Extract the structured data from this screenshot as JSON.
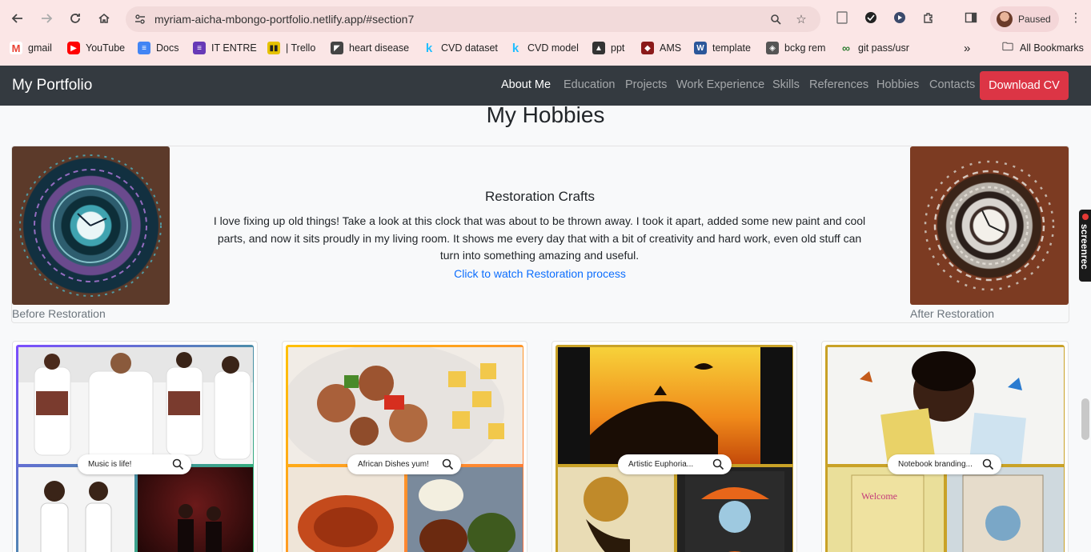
{
  "browser": {
    "url": "myriam-aicha-mbongo-portfolio.netlify.app/#section7",
    "profile_status": "Paused",
    "bookmarks": [
      {
        "label": "gmail",
        "icon": "gmail-icon",
        "color": "#ea4335"
      },
      {
        "label": "YouTube",
        "icon": "youtube-icon",
        "color": "#ff0000"
      },
      {
        "label": "Docs",
        "icon": "docs-icon",
        "color": "#4285f4"
      },
      {
        "label": "IT ENTRE",
        "icon": "forms-icon",
        "color": "#673ab7"
      },
      {
        "label": "| Trello",
        "icon": "trello-icon",
        "color": "#e6c200"
      },
      {
        "label": "heart disease",
        "icon": "kaggle-icon",
        "color": "#444444"
      },
      {
        "label": "CVD dataset",
        "icon": "kaggle-k-icon",
        "color": "#20beff"
      },
      {
        "label": "CVD model",
        "icon": "kaggle-k-icon",
        "color": "#20beff"
      },
      {
        "label": "ppt",
        "icon": "ppt-icon",
        "color": "#333333"
      },
      {
        "label": "AMS",
        "icon": "ams-icon",
        "color": "#8b1a1a"
      },
      {
        "label": "template",
        "icon": "word-icon",
        "color": "#2b579a"
      },
      {
        "label": "bckg rem",
        "icon": "layers-icon",
        "color": "#555555"
      },
      {
        "label": "git pass/usr",
        "icon": "git-icon",
        "color": "#2e7d32"
      }
    ],
    "all_bookmarks": "All Bookmarks",
    "overflow": "»"
  },
  "navbar": {
    "brand": "My Portfolio",
    "items": [
      "About Me",
      "Education",
      "Projects",
      "Work Experience",
      "Skills",
      "References",
      "Hobbies",
      "Contacts"
    ],
    "active": "About Me",
    "cta": "Download CV"
  },
  "hobbies": {
    "title": "My Hobbies",
    "restoration": {
      "title": "Restoration Crafts",
      "text": "I love fixing up old things! Take a look at this clock that was about to be thrown away. I took it apart, added some new paint and cool parts, and now it sits proudly in my living room. It shows me every day that with a bit of creativity and hard work, even old stuff can turn into something amazing and useful.",
      "link": "Click to watch Restoration process",
      "before_caption": "Before Restoration",
      "after_caption": "After Restoration"
    },
    "tiles": [
      {
        "label": "Music is life!",
        "border": "#7c4dff"
      },
      {
        "label": "African Dishes yum!",
        "border": "#ff9800"
      },
      {
        "label": "Artistic Euphoria...",
        "border": "#c9a227"
      },
      {
        "label": "Notebook branding...",
        "border": "#c9a227"
      }
    ]
  },
  "overlay": {
    "screenrec": "screenrec"
  }
}
